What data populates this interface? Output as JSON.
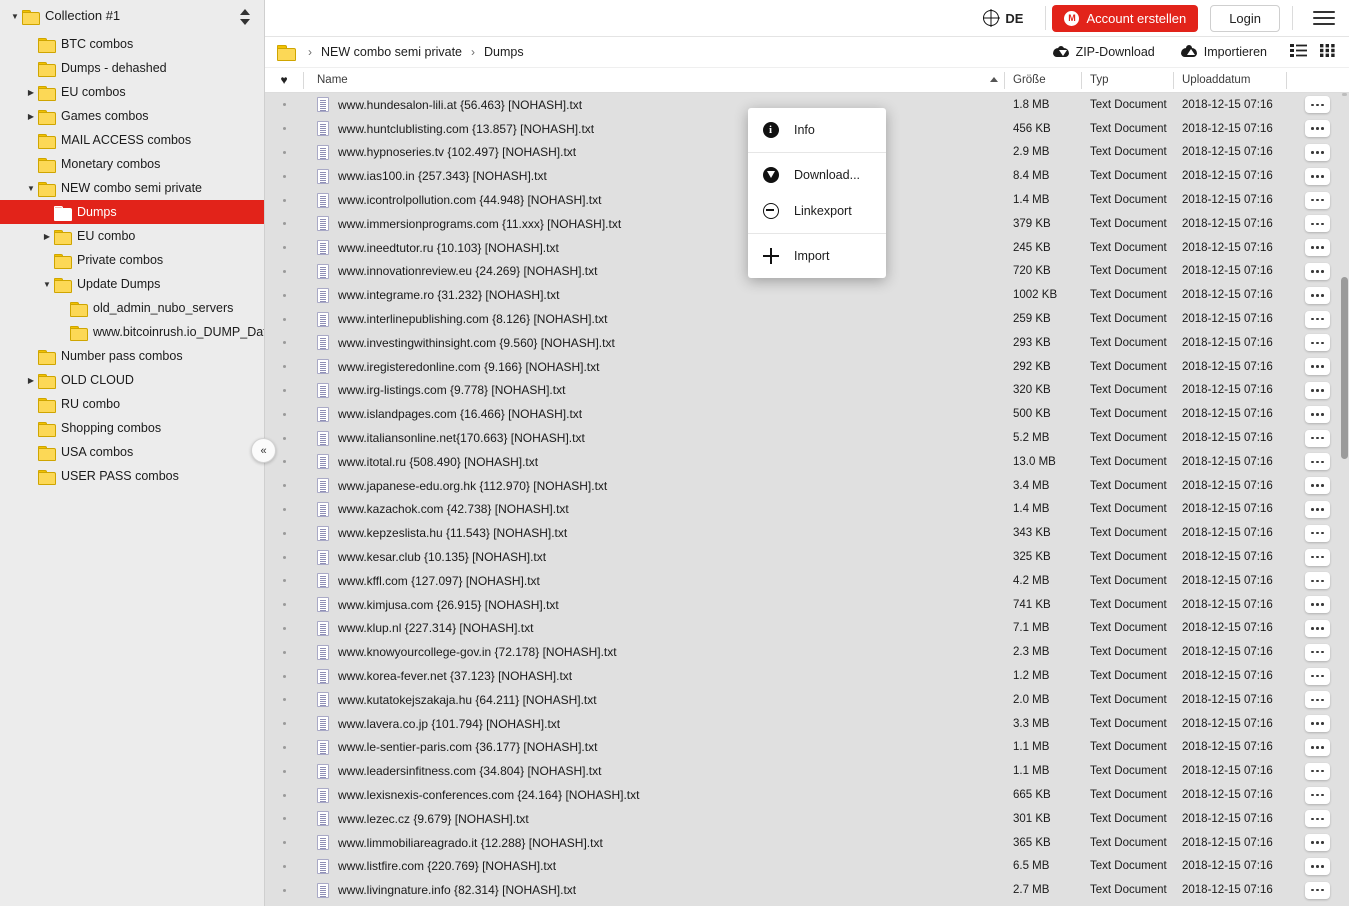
{
  "topbar": {
    "lang_label": "DE",
    "register_label": "Account erstellen",
    "register_color": "#e2231a",
    "login_label": "Login",
    "mega_mark": "M"
  },
  "sidebar": {
    "root_label": "Collection #1",
    "items": [
      {
        "label": "BTC combos",
        "depth": 2,
        "caret": "none",
        "selected": false
      },
      {
        "label": "Dumps - dehashed",
        "depth": 2,
        "caret": "none",
        "selected": false
      },
      {
        "label": "EU combos",
        "depth": 2,
        "caret": "collapsed",
        "selected": false
      },
      {
        "label": "Games combos",
        "depth": 2,
        "caret": "collapsed",
        "selected": false
      },
      {
        "label": "MAIL ACCESS combos",
        "depth": 2,
        "caret": "none",
        "selected": false
      },
      {
        "label": "Monetary combos",
        "depth": 2,
        "caret": "none",
        "selected": false
      },
      {
        "label": "NEW combo semi private",
        "depth": 2,
        "caret": "expanded",
        "selected": false
      },
      {
        "label": "Dumps",
        "depth": 3,
        "caret": "none",
        "selected": true
      },
      {
        "label": "EU combo",
        "depth": 3,
        "caret": "collapsed",
        "selected": false
      },
      {
        "label": "Private combos",
        "depth": 3,
        "caret": "none",
        "selected": false
      },
      {
        "label": "Update Dumps",
        "depth": 3,
        "caret": "expanded",
        "selected": false
      },
      {
        "label": "old_admin_nubo_servers",
        "depth": 4,
        "caret": "none",
        "selected": false
      },
      {
        "label": "www.bitcoinrush.io_DUMP_Data",
        "depth": 4,
        "caret": "none",
        "selected": false
      },
      {
        "label": "Number pass combos",
        "depth": 2,
        "caret": "none",
        "selected": false
      },
      {
        "label": "OLD CLOUD",
        "depth": 2,
        "caret": "collapsed",
        "selected": false
      },
      {
        "label": "RU combo",
        "depth": 2,
        "caret": "none",
        "selected": false
      },
      {
        "label": "Shopping combos",
        "depth": 2,
        "caret": "none",
        "selected": false
      },
      {
        "label": "USA combos",
        "depth": 2,
        "caret": "none",
        "selected": false
      },
      {
        "label": "USER PASS combos",
        "depth": 2,
        "caret": "none",
        "selected": false
      }
    ],
    "collapse_label": "«",
    "selected_color": "#e2231a"
  },
  "breadcrumb": {
    "path": [
      "NEW combo semi private",
      "Dumps"
    ],
    "separator": "›"
  },
  "actions": {
    "zip_download": "ZIP-Download",
    "import": "Importieren"
  },
  "columns": {
    "favorite": "♥",
    "name": "Name",
    "size": "Größe",
    "type": "Typ",
    "date": "Uploaddatum",
    "sorted_by": "name",
    "sort_direction": "asc"
  },
  "context_menu": {
    "items": [
      {
        "label": "Info",
        "icon": "info-icon"
      },
      {
        "label": "Download...",
        "icon": "download-icon"
      },
      {
        "label": "Linkexport",
        "icon": "link-icon"
      },
      {
        "label": "Import",
        "icon": "plus-icon"
      }
    ]
  },
  "files": [
    {
      "name": "www.hundesalon-lili.at {56.463} [NOHASH].txt",
      "size": "1.8 MB",
      "type": "Text Document",
      "date": "2018-12-15 07:16"
    },
    {
      "name": "www.huntclublisting.com {13.857} [NOHASH].txt",
      "size": "456 KB",
      "type": "Text Document",
      "date": "2018-12-15 07:16"
    },
    {
      "name": "www.hypnoseries.tv {102.497} [NOHASH].txt",
      "size": "2.9 MB",
      "type": "Text Document",
      "date": "2018-12-15 07:16"
    },
    {
      "name": "www.ias100.in {257.343} [NOHASH].txt",
      "size": "8.4 MB",
      "type": "Text Document",
      "date": "2018-12-15 07:16"
    },
    {
      "name": "www.icontrolpollution.com {44.948} [NOHASH].txt",
      "size": "1.4 MB",
      "type": "Text Document",
      "date": "2018-12-15 07:16"
    },
    {
      "name": "www.immersionprograms.com {11.xxx} [NOHASH].txt",
      "size": "379 KB",
      "type": "Text Document",
      "date": "2018-12-15 07:16"
    },
    {
      "name": "www.ineedtutor.ru {10.103} [NOHASH].txt",
      "size": "245 KB",
      "type": "Text Document",
      "date": "2018-12-15 07:16"
    },
    {
      "name": "www.innovationreview.eu {24.269} [NOHASH].txt",
      "size": "720 KB",
      "type": "Text Document",
      "date": "2018-12-15 07:16"
    },
    {
      "name": "www.integrame.ro {31.232} [NOHASH].txt",
      "size": "1002 KB",
      "type": "Text Document",
      "date": "2018-12-15 07:16"
    },
    {
      "name": "www.interlinepublishing.com {8.126} [NOHASH].txt",
      "size": "259 KB",
      "type": "Text Document",
      "date": "2018-12-15 07:16"
    },
    {
      "name": "www.investingwithinsight.com {9.560} [NOHASH].txt",
      "size": "293 KB",
      "type": "Text Document",
      "date": "2018-12-15 07:16"
    },
    {
      "name": "www.iregisteredonline.com {9.166} [NOHASH].txt",
      "size": "292 KB",
      "type": "Text Document",
      "date": "2018-12-15 07:16"
    },
    {
      "name": "www.irg-listings.com {9.778} [NOHASH].txt",
      "size": "320 KB",
      "type": "Text Document",
      "date": "2018-12-15 07:16"
    },
    {
      "name": "www.islandpages.com {16.466} [NOHASH].txt",
      "size": "500 KB",
      "type": "Text Document",
      "date": "2018-12-15 07:16"
    },
    {
      "name": "www.italiansonline.net{170.663} [NOHASH].txt",
      "size": "5.2 MB",
      "type": "Text Document",
      "date": "2018-12-15 07:16"
    },
    {
      "name": "www.itotal.ru {508.490} [NOHASH].txt",
      "size": "13.0 MB",
      "type": "Text Document",
      "date": "2018-12-15 07:16"
    },
    {
      "name": "www.japanese-edu.org.hk {112.970} [NOHASH].txt",
      "size": "3.4 MB",
      "type": "Text Document",
      "date": "2018-12-15 07:16"
    },
    {
      "name": "www.kazachok.com {42.738} [NOHASH].txt",
      "size": "1.4 MB",
      "type": "Text Document",
      "date": "2018-12-15 07:16"
    },
    {
      "name": "www.kepzeslista.hu {11.543} [NOHASH].txt",
      "size": "343 KB",
      "type": "Text Document",
      "date": "2018-12-15 07:16"
    },
    {
      "name": "www.kesar.club {10.135} [NOHASH].txt",
      "size": "325 KB",
      "type": "Text Document",
      "date": "2018-12-15 07:16"
    },
    {
      "name": "www.kffl.com {127.097} [NOHASH].txt",
      "size": "4.2 MB",
      "type": "Text Document",
      "date": "2018-12-15 07:16"
    },
    {
      "name": "www.kimjusa.com {26.915} [NOHASH].txt",
      "size": "741 KB",
      "type": "Text Document",
      "date": "2018-12-15 07:16"
    },
    {
      "name": "www.klup.nl {227.314} [NOHASH].txt",
      "size": "7.1 MB",
      "type": "Text Document",
      "date": "2018-12-15 07:16"
    },
    {
      "name": "www.knowyourcollege-gov.in {72.178} [NOHASH].txt",
      "size": "2.3 MB",
      "type": "Text Document",
      "date": "2018-12-15 07:16"
    },
    {
      "name": "www.korea-fever.net {37.123} [NOHASH].txt",
      "size": "1.2 MB",
      "type": "Text Document",
      "date": "2018-12-15 07:16"
    },
    {
      "name": "www.kutatokejszakaja.hu {64.211} [NOHASH].txt",
      "size": "2.0 MB",
      "type": "Text Document",
      "date": "2018-12-15 07:16"
    },
    {
      "name": "www.lavera.co.jp {101.794} [NOHASH].txt",
      "size": "3.3 MB",
      "type": "Text Document",
      "date": "2018-12-15 07:16"
    },
    {
      "name": "www.le-sentier-paris.com {36.177} [NOHASH].txt",
      "size": "1.1 MB",
      "type": "Text Document",
      "date": "2018-12-15 07:16"
    },
    {
      "name": "www.leadersinfitness.com {34.804} [NOHASH].txt",
      "size": "1.1 MB",
      "type": "Text Document",
      "date": "2018-12-15 07:16"
    },
    {
      "name": "www.lexisnexis-conferences.com {24.164} [NOHASH].txt",
      "size": "665 KB",
      "type": "Text Document",
      "date": "2018-12-15 07:16"
    },
    {
      "name": "www.lezec.cz {9.679} [NOHASH].txt",
      "size": "301 KB",
      "type": "Text Document",
      "date": "2018-12-15 07:16"
    },
    {
      "name": "www.limmobiliareagrado.it {12.288} [NOHASH].txt",
      "size": "365 KB",
      "type": "Text Document",
      "date": "2018-12-15 07:16"
    },
    {
      "name": "www.listfire.com {220.769} [NOHASH].txt",
      "size": "6.5 MB",
      "type": "Text Document",
      "date": "2018-12-15 07:16"
    },
    {
      "name": "www.livingnature.info {82.314} [NOHASH].txt",
      "size": "2.7 MB",
      "type": "Text Document",
      "date": "2018-12-15 07:16"
    }
  ]
}
